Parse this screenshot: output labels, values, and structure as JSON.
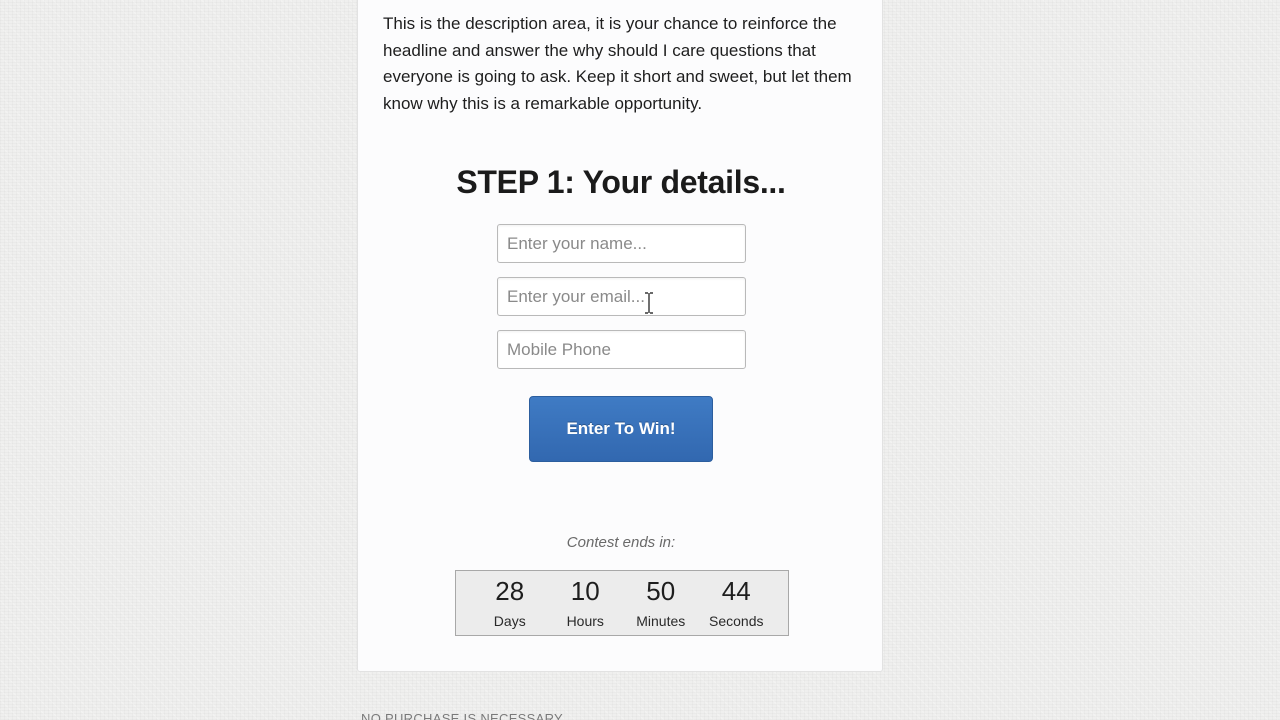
{
  "description": "This is the description area, it is your chance to reinforce the headline and answer the why should I care questions that everyone is going to ask. Keep it short and sweet, but let them know why this is a remarkable opportunity.",
  "step_title": "STEP 1: Your details...",
  "form": {
    "name_placeholder": "Enter your name...",
    "email_placeholder": "Enter your email...",
    "phone_placeholder": "Mobile Phone",
    "submit_label": "Enter To Win!",
    "submit_color": "#3a72bb"
  },
  "countdown": {
    "label": "Contest ends in:",
    "days": {
      "value": "28",
      "label": "Days"
    },
    "hours": {
      "value": "10",
      "label": "Hours"
    },
    "minutes": {
      "value": "50",
      "label": "Minutes"
    },
    "seconds": {
      "value": "44",
      "label": "Seconds"
    }
  },
  "footer": {
    "note": "NO PURCHASE IS NECESSARY"
  },
  "pointer": {
    "icon": "text-cursor-icon"
  }
}
